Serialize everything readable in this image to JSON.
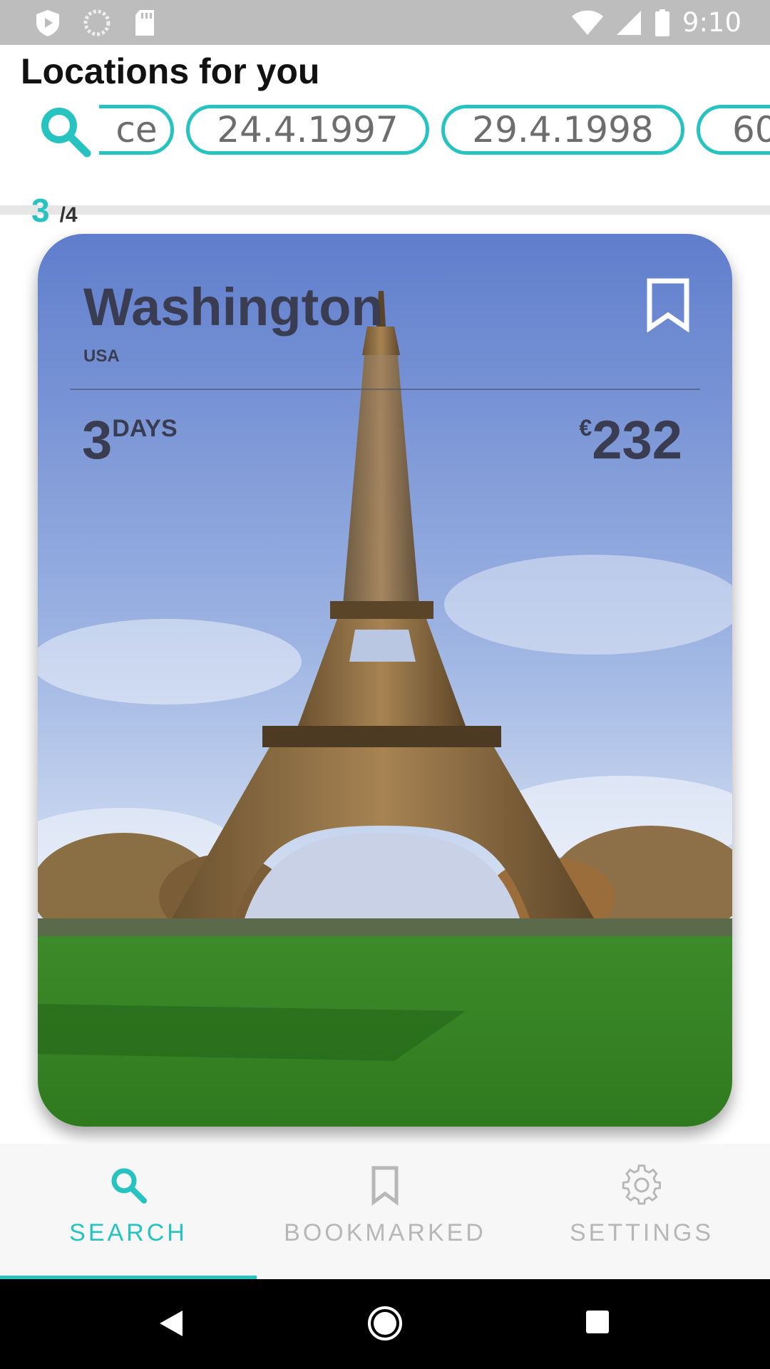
{
  "status_bar": {
    "time": "9:10",
    "icons": [
      "play-protect-icon",
      "sync-icon",
      "sd-card-icon",
      "wifi-icon",
      "signal-icon",
      "battery-icon"
    ]
  },
  "header": {
    "title": "Locations for you",
    "search_icon": "search-icon",
    "chips": [
      "ce",
      "24.4.1997",
      "29.4.1998",
      "60"
    ]
  },
  "counter": {
    "current": "3",
    "total": "/4"
  },
  "card": {
    "city": "Washington",
    "country": "USA",
    "days_number": "3",
    "days_unit": "DAYS",
    "price_currency": "€",
    "price_value": "232",
    "bookmark_icon": "bookmark-outline-icon",
    "image": "eiffel-tower-photo"
  },
  "bottom_nav": {
    "items": [
      {
        "label": "SEARCH",
        "icon": "search-icon",
        "active": true
      },
      {
        "label": "BOOKMARKED",
        "icon": "bookmark-icon",
        "active": false
      },
      {
        "label": "SETTINGS",
        "icon": "gear-icon",
        "active": false
      }
    ]
  },
  "system_nav": {
    "icons": [
      "back-icon",
      "home-icon",
      "recents-icon"
    ]
  },
  "colors": {
    "accent": "#26c3c1",
    "card_text": "#3a3d52",
    "status_bar": "#bdbdbd",
    "inactive": "#b7b7b7"
  }
}
